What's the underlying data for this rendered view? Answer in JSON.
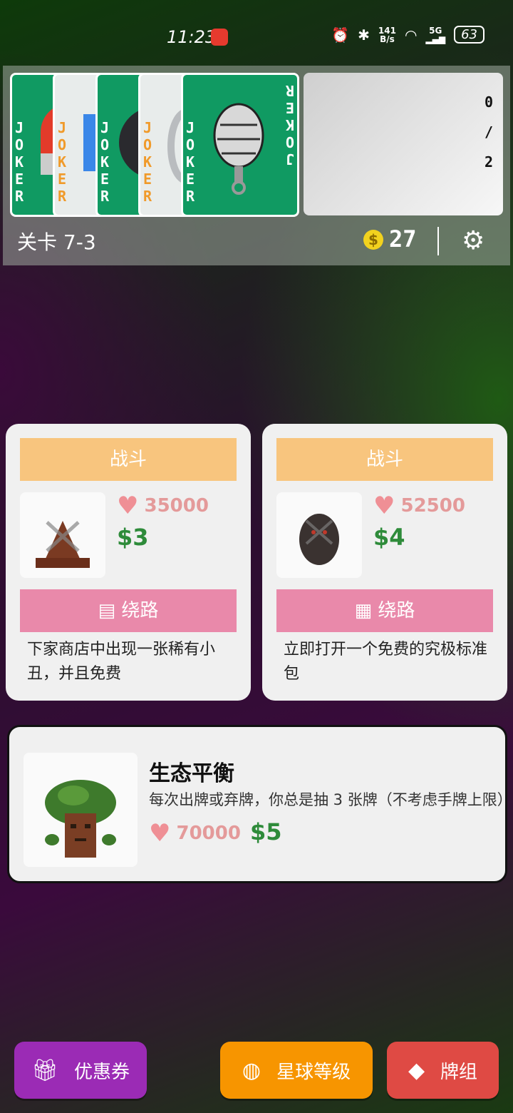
{
  "status_bar": {
    "time": "11:23",
    "net_speed_top": "141",
    "net_speed_bottom": "B/s",
    "network": "5G",
    "battery": "63"
  },
  "top_panel": {
    "joker_label": "JOKER",
    "slot_count": [
      "0",
      "/",
      "2"
    ],
    "level": "关卡 7-3",
    "coin_symbol": "$",
    "money": "27"
  },
  "cards": [
    {
      "battle_label": "战斗",
      "hp": "35000",
      "price": "$3",
      "skip_label": "绕路",
      "skip_icon": "gift-icon",
      "description": "下家商店中出现一张稀有小丑，并且免费"
    },
    {
      "battle_label": "战斗",
      "hp": "52500",
      "price": "$4",
      "skip_label": "绕路",
      "skip_icon": "grid-icon",
      "description": "立即打开一个免费的究极标准包"
    }
  ],
  "boss": {
    "title": "生态平衡",
    "description": "每次出牌或弃牌，你总是抽 3 张牌（不考虑手牌上限）",
    "hp": "70000",
    "price": "$5"
  },
  "buttons": {
    "coupon": "优惠券",
    "planet": "星球等级",
    "deck": "牌组"
  },
  "colors": {
    "joker_green": "#109a62",
    "battle": "#f8c57e",
    "skip": "#e989aa",
    "price": "#2e8b3a",
    "coupon": "#9b2bb5",
    "planet": "#f79500",
    "deck": "#df4a44"
  }
}
